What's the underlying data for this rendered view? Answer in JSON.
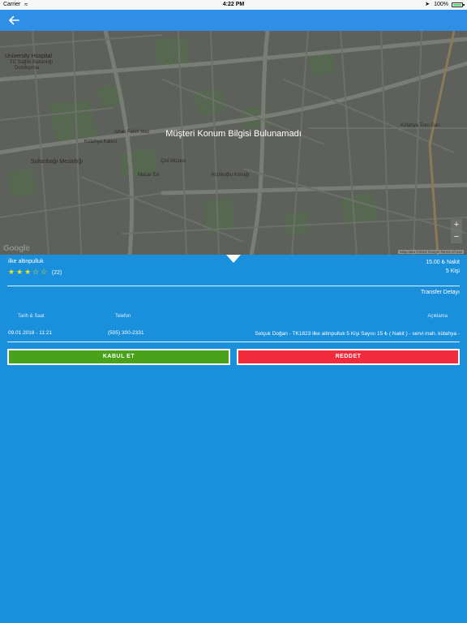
{
  "status_bar": {
    "carrier": "Carrier",
    "time": "4:22 PM",
    "battery": "100%"
  },
  "map": {
    "message": "Müşteri Konum Bilgisi Bulunamadı",
    "labels": {
      "university_hospital": "University Hospital",
      "tc_saglik": "TC Sağlık Bakanlığı",
      "dumlupinar": "Dumlupınar",
      "ishak_fakih": "İshak Fakih Mec",
      "kutahya_kalesi": "Kütahya Kalesi",
      "sultanbagi": "Sultanbağı Mezarlığı",
      "cini_muzesi": "Çini Müzesi",
      "macar_evi": "Macar Evi",
      "kizilkoglu": "Kızılkoğlu Konağı",
      "kutahya_tren_gari": "Kütahya Tren Garı"
    },
    "google_logo": "Google",
    "attribution": "Map data ©2018 Google   Terms of Use",
    "zoom_in": "+",
    "zoom_out": "−"
  },
  "customer": {
    "name": "ilke altinpulluk",
    "rating_stars": 3,
    "rating_max": 5,
    "rating_count": "(22)"
  },
  "price": "15.00 ₺ Nakit",
  "person_count": "5 Kişi",
  "transfer_detail_label": "Transfer Detayı",
  "columns": {
    "date_time": "Tarih & Saat",
    "phone": "Telefon",
    "description": "Açıklama"
  },
  "row": {
    "date_time": "09.01.2018 - 11:21",
    "phone": "(505) 300-2331",
    "description": "Selçuk Doğan - TK1823 ilke altinpulluk 5 Kişi Sayısı 15 ₺ ( Nakit ) - servi mah. kütahya -"
  },
  "buttons": {
    "accept": "KABUL ET",
    "reject": "REDDET"
  },
  "colors": {
    "background": "#1a8fdc",
    "nav_bar": "#2f8ee6",
    "accept": "#4aa21a",
    "reject": "#f12b3c",
    "stars": "#f5e31a"
  },
  "icons": {
    "back": "arrow-left-icon",
    "wifi": "wifi-icon",
    "location": "location-arrow-icon",
    "battery": "battery-icon"
  }
}
